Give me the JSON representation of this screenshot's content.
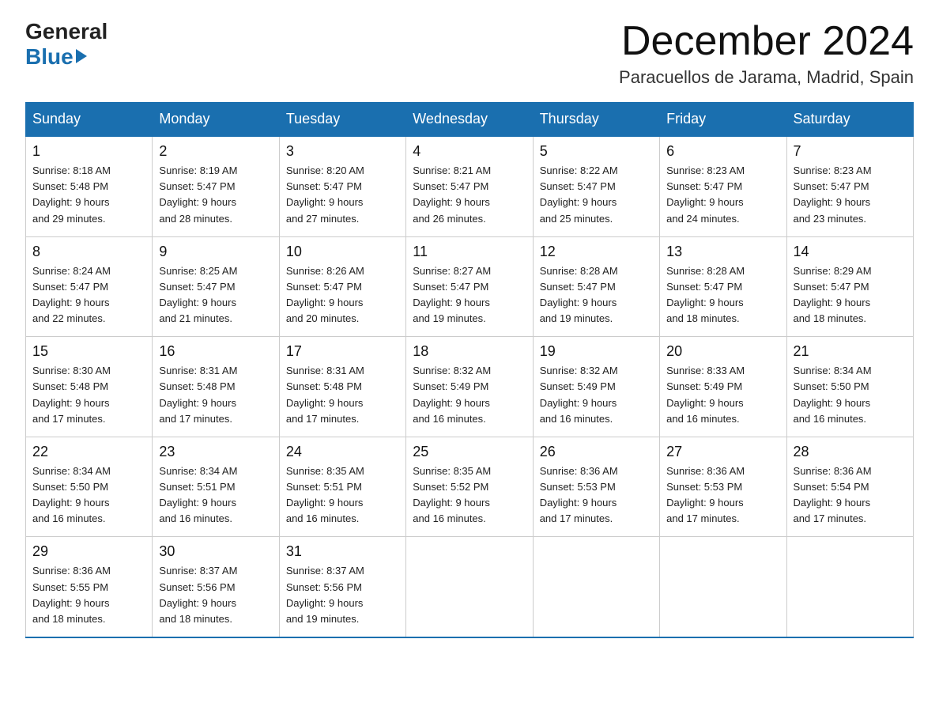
{
  "header": {
    "logo_general": "General",
    "logo_blue": "Blue",
    "month_title": "December 2024",
    "location": "Paracuellos de Jarama, Madrid, Spain"
  },
  "days_of_week": [
    "Sunday",
    "Monday",
    "Tuesday",
    "Wednesday",
    "Thursday",
    "Friday",
    "Saturday"
  ],
  "weeks": [
    [
      {
        "day": "1",
        "sunrise": "8:18 AM",
        "sunset": "5:48 PM",
        "daylight": "9 hours and 29 minutes."
      },
      {
        "day": "2",
        "sunrise": "8:19 AM",
        "sunset": "5:47 PM",
        "daylight": "9 hours and 28 minutes."
      },
      {
        "day": "3",
        "sunrise": "8:20 AM",
        "sunset": "5:47 PM",
        "daylight": "9 hours and 27 minutes."
      },
      {
        "day": "4",
        "sunrise": "8:21 AM",
        "sunset": "5:47 PM",
        "daylight": "9 hours and 26 minutes."
      },
      {
        "day": "5",
        "sunrise": "8:22 AM",
        "sunset": "5:47 PM",
        "daylight": "9 hours and 25 minutes."
      },
      {
        "day": "6",
        "sunrise": "8:23 AM",
        "sunset": "5:47 PM",
        "daylight": "9 hours and 24 minutes."
      },
      {
        "day": "7",
        "sunrise": "8:23 AM",
        "sunset": "5:47 PM",
        "daylight": "9 hours and 23 minutes."
      }
    ],
    [
      {
        "day": "8",
        "sunrise": "8:24 AM",
        "sunset": "5:47 PM",
        "daylight": "9 hours and 22 minutes."
      },
      {
        "day": "9",
        "sunrise": "8:25 AM",
        "sunset": "5:47 PM",
        "daylight": "9 hours and 21 minutes."
      },
      {
        "day": "10",
        "sunrise": "8:26 AM",
        "sunset": "5:47 PM",
        "daylight": "9 hours and 20 minutes."
      },
      {
        "day": "11",
        "sunrise": "8:27 AM",
        "sunset": "5:47 PM",
        "daylight": "9 hours and 19 minutes."
      },
      {
        "day": "12",
        "sunrise": "8:28 AM",
        "sunset": "5:47 PM",
        "daylight": "9 hours and 19 minutes."
      },
      {
        "day": "13",
        "sunrise": "8:28 AM",
        "sunset": "5:47 PM",
        "daylight": "9 hours and 18 minutes."
      },
      {
        "day": "14",
        "sunrise": "8:29 AM",
        "sunset": "5:47 PM",
        "daylight": "9 hours and 18 minutes."
      }
    ],
    [
      {
        "day": "15",
        "sunrise": "8:30 AM",
        "sunset": "5:48 PM",
        "daylight": "9 hours and 17 minutes."
      },
      {
        "day": "16",
        "sunrise": "8:31 AM",
        "sunset": "5:48 PM",
        "daylight": "9 hours and 17 minutes."
      },
      {
        "day": "17",
        "sunrise": "8:31 AM",
        "sunset": "5:48 PM",
        "daylight": "9 hours and 17 minutes."
      },
      {
        "day": "18",
        "sunrise": "8:32 AM",
        "sunset": "5:49 PM",
        "daylight": "9 hours and 16 minutes."
      },
      {
        "day": "19",
        "sunrise": "8:32 AM",
        "sunset": "5:49 PM",
        "daylight": "9 hours and 16 minutes."
      },
      {
        "day": "20",
        "sunrise": "8:33 AM",
        "sunset": "5:49 PM",
        "daylight": "9 hours and 16 minutes."
      },
      {
        "day": "21",
        "sunrise": "8:34 AM",
        "sunset": "5:50 PM",
        "daylight": "9 hours and 16 minutes."
      }
    ],
    [
      {
        "day": "22",
        "sunrise": "8:34 AM",
        "sunset": "5:50 PM",
        "daylight": "9 hours and 16 minutes."
      },
      {
        "day": "23",
        "sunrise": "8:34 AM",
        "sunset": "5:51 PM",
        "daylight": "9 hours and 16 minutes."
      },
      {
        "day": "24",
        "sunrise": "8:35 AM",
        "sunset": "5:51 PM",
        "daylight": "9 hours and 16 minutes."
      },
      {
        "day": "25",
        "sunrise": "8:35 AM",
        "sunset": "5:52 PM",
        "daylight": "9 hours and 16 minutes."
      },
      {
        "day": "26",
        "sunrise": "8:36 AM",
        "sunset": "5:53 PM",
        "daylight": "9 hours and 17 minutes."
      },
      {
        "day": "27",
        "sunrise": "8:36 AM",
        "sunset": "5:53 PM",
        "daylight": "9 hours and 17 minutes."
      },
      {
        "day": "28",
        "sunrise": "8:36 AM",
        "sunset": "5:54 PM",
        "daylight": "9 hours and 17 minutes."
      }
    ],
    [
      {
        "day": "29",
        "sunrise": "8:36 AM",
        "sunset": "5:55 PM",
        "daylight": "9 hours and 18 minutes."
      },
      {
        "day": "30",
        "sunrise": "8:37 AM",
        "sunset": "5:56 PM",
        "daylight": "9 hours and 18 minutes."
      },
      {
        "day": "31",
        "sunrise": "8:37 AM",
        "sunset": "5:56 PM",
        "daylight": "9 hours and 19 minutes."
      },
      null,
      null,
      null,
      null
    ]
  ],
  "labels": {
    "sunrise": "Sunrise:",
    "sunset": "Sunset:",
    "daylight": "Daylight:"
  }
}
